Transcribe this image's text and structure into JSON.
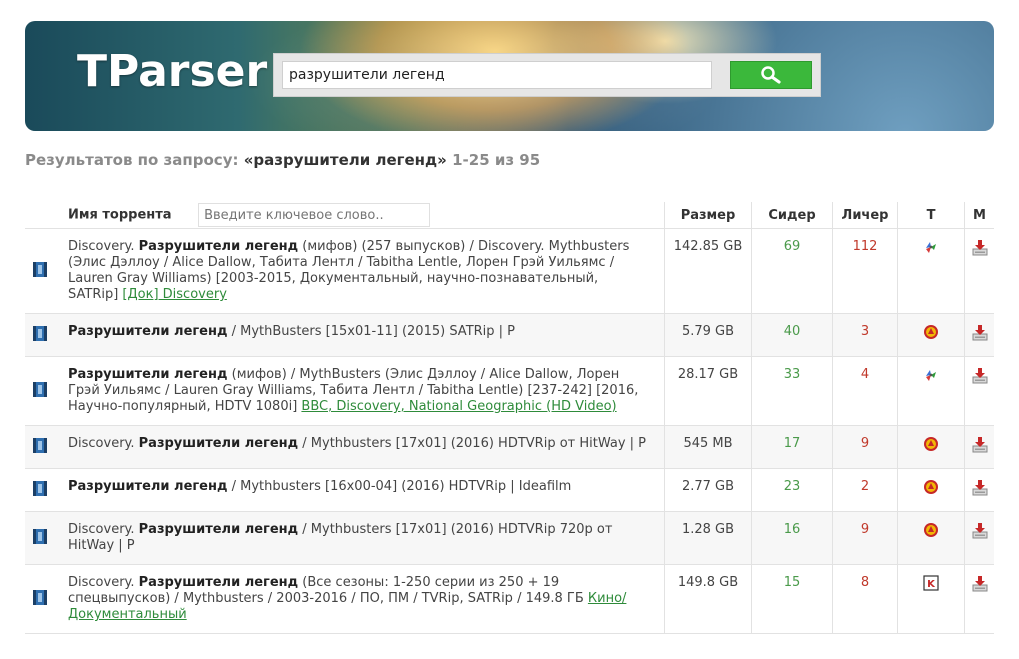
{
  "header": {
    "logo": "TParser",
    "search_value": "разрушители легенд"
  },
  "results_summary": {
    "prefix": "Результатов по запросу:",
    "query": "«разрушители легенд»",
    "range": "1-25 из 95"
  },
  "table": {
    "headers": {
      "name": "Имя торрента",
      "size": "Размер",
      "seeders": "Сидер",
      "leechers": "Личер",
      "tracker": "T",
      "magnet": "M"
    },
    "filter_placeholder": "Введите ключевое слово..",
    "rows": [
      {
        "pre": "Discovery. ",
        "bold": "Разрушители легенд",
        "rest": " (мифов) (257 выпусков) / Discovery. Mythbusters (Элис Дэллоу / Alice Dallow, Табита Лентл / Tabitha Lentle, Лорен Грэй Уильямс / Lauren Gray Williams) [2003-2015, Документальный, научно-познавательный, SATRip] ",
        "link": "[Док] Discovery",
        "size": "142.85 GB",
        "seeders": "69",
        "leechers": "112",
        "tracker": "rutracker-icon"
      },
      {
        "pre": "",
        "bold": "Разрушители легенд",
        "rest": " / MythBusters [15x01-11] (2015) SATRip | P",
        "link": "",
        "size": "5.79 GB",
        "seeders": "40",
        "leechers": "3",
        "tracker": "rutor-icon"
      },
      {
        "pre": "",
        "bold": "Разрушители легенд",
        "rest": " (мифов) / MythBusters (Элис Дэллоу / Alice Dallow, Лорен Грэй Уильямс / Lauren Gray Williams, Табита Лентл / Tabitha Lentle) [237-242] [2016, Научно-популярный, HDTV 1080i] ",
        "link": "BBC, Discovery, National Geographic (HD Video)",
        "size": "28.17 GB",
        "seeders": "33",
        "leechers": "4",
        "tracker": "rutracker-icon"
      },
      {
        "pre": "Discovery. ",
        "bold": "Разрушители легенд",
        "rest": " / Mythbusters [17x01] (2016) HDTVRip от HitWay | P",
        "link": "",
        "size": "545 MB",
        "seeders": "17",
        "leechers": "9",
        "tracker": "rutor-icon"
      },
      {
        "pre": "",
        "bold": "Разрушители легенд",
        "rest": " / Mythbusters [16x00-04] (2016) HDTVRip | Ideafilm",
        "link": "",
        "size": "2.77 GB",
        "seeders": "23",
        "leechers": "2",
        "tracker": "rutor-icon"
      },
      {
        "pre": "Discovery. ",
        "bold": "Разрушители легенд",
        "rest": " / Mythbusters [17x01] (2016) HDTVRip 720p от HitWay | P",
        "link": "",
        "size": "1.28 GB",
        "seeders": "16",
        "leechers": "9",
        "tracker": "rutor-icon"
      },
      {
        "pre": "Discovery. ",
        "bold": "Разрушители легенд",
        "rest": " (Все сезоны: 1-250 серии из 250 + 19 спецвыпусков) / Mythbusters / 2003-2016 / ПО, ПМ / TVRip, SATRip / 149.8 ГБ ",
        "link": "Кино/Документальный",
        "size": "149.8 GB",
        "seeders": "15",
        "leechers": "8",
        "tracker": "kinozal-icon"
      }
    ]
  }
}
